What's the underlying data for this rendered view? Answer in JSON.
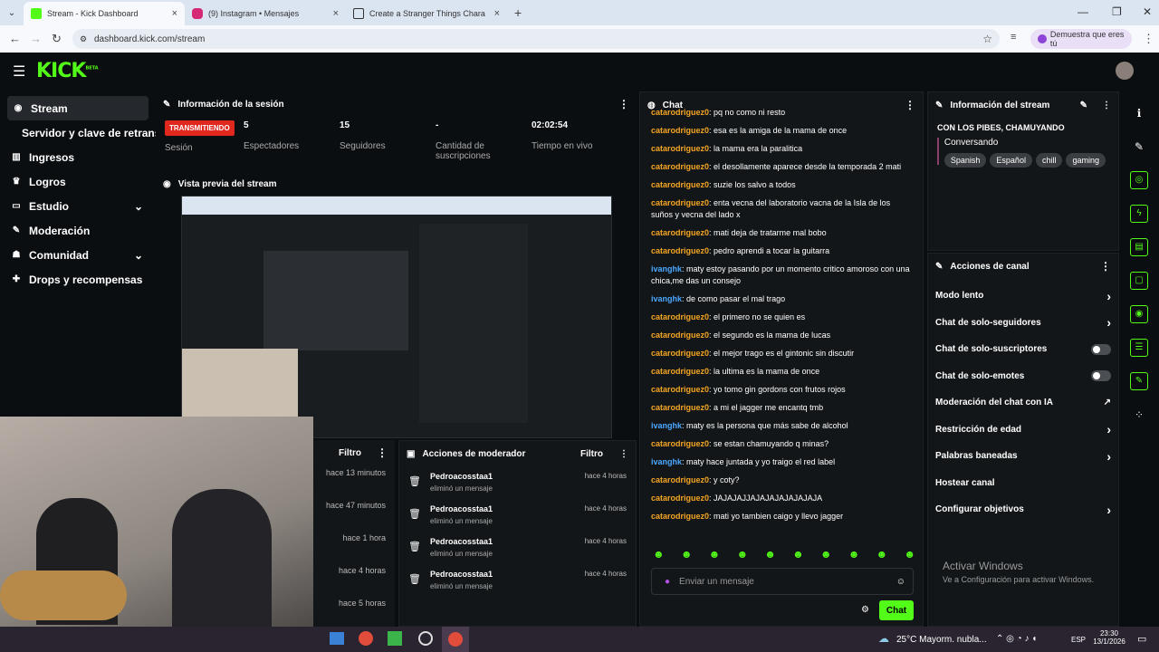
{
  "tabs": [
    {
      "title": "Stream - Kick Dashboard",
      "color": "#53fc18"
    },
    {
      "title": "(9) Instagram • Mensajes",
      "color": "#d62976"
    },
    {
      "title": "Create a Stranger Things Chara",
      "color": "#333333"
    }
  ],
  "address": {
    "url": "dashboard.kick.com/stream",
    "pill": "Demuestra que eres tú"
  },
  "logo": "KICK",
  "logo_sup": "BETA",
  "sidebar": [
    {
      "label": "Stream",
      "icon": "stream-icon",
      "active": true
    },
    {
      "label": "Servidor y clave de retransm",
      "icon": ""
    },
    {
      "label": "Ingresos",
      "icon": "chart-icon"
    },
    {
      "label": "Logros",
      "icon": "trophy-icon"
    },
    {
      "label": "Estudio",
      "icon": "studio-icon",
      "chevron": true
    },
    {
      "label": "Moderación",
      "icon": "wrench-icon"
    },
    {
      "label": "Comunidad",
      "icon": "people-icon",
      "chevron": true
    },
    {
      "label": "Drops y recompensas",
      "icon": "gift-icon"
    }
  ],
  "session": {
    "title": "Información de la sesión",
    "badge": "TRANSMITIENDO",
    "badge_label": "Sesión",
    "stats": [
      {
        "value": "5",
        "label": "Espectadores"
      },
      {
        "value": "15",
        "label": "Seguidores"
      },
      {
        "value": "-",
        "label": "Cantidad de suscripciones"
      },
      {
        "value": "02:02:54",
        "label": "Tiempo en vivo"
      }
    ]
  },
  "preview": {
    "title": "Vista previa del stream"
  },
  "filter_panel": {
    "label": "Filtro",
    "times": [
      "hace 13 minutos",
      "hace 47 minutos",
      "hace 1 hora",
      "hace 4 horas",
      "hace 5 horas"
    ]
  },
  "mod_actions": {
    "title": "Acciones de moderador",
    "filter": "Filtro",
    "items": [
      {
        "user": "Pedroacosstaa1",
        "action": "eliminó un mensaje",
        "time": "hace 4 horas"
      },
      {
        "user": "Pedroacosstaa1",
        "action": "eliminó un mensaje",
        "time": "hace 4 horas"
      },
      {
        "user": "Pedroacosstaa1",
        "action": "eliminó un mensaje",
        "time": "hace 4 horas"
      },
      {
        "user": "Pedroacosstaa1",
        "action": "eliminó un mensaje",
        "time": "hace 4 horas"
      }
    ]
  },
  "chat": {
    "title": "Chat",
    "messages": [
      {
        "user": "catarodriguez0",
        "text": "pq no como ni resto",
        "t": 1
      },
      {
        "user": "catarodriguez0",
        "text": "esa es la amiga de la mama de once",
        "t": 1
      },
      {
        "user": "catarodriguez0",
        "text": "la mama era la paralitica",
        "t": 1
      },
      {
        "user": "catarodriguez0",
        "text": "el desollamente aparece desde la temporada 2 mati",
        "t": 1
      },
      {
        "user": "catarodriguez0",
        "text": "suzie los salvo a todos",
        "t": 1
      },
      {
        "user": "catarodriguez0",
        "text": "enta vecna del laboratorio vacna de la Isla de los suños y vecna del lado x",
        "t": 1
      },
      {
        "user": "catarodriguez0",
        "text": "mati deja de tratarme mal bobo",
        "t": 1
      },
      {
        "user": "catarodriguez0",
        "text": "pedro aprendi a tocar la guitarra",
        "t": 1
      },
      {
        "user": "ivanghk",
        "text": "maty estoy pasando por un momento critico amoroso con una chica,me das un consejo",
        "t": 2
      },
      {
        "user": "ivanghk",
        "text": "de como pasar el mal trago",
        "t": 2
      },
      {
        "user": "catarodriguez0",
        "text": "el primero no se quien es",
        "t": 1
      },
      {
        "user": "catarodriguez0",
        "text": "el segundo es la mama de lucas",
        "t": 1
      },
      {
        "user": "catarodriguez0",
        "text": "el mejor trago es el gintonic sin discutir",
        "t": 1
      },
      {
        "user": "catarodriguez0",
        "text": "la ultima es la mama de once",
        "t": 1
      },
      {
        "user": "catarodriguez0",
        "text": "yo tomo gin gordons con frutos rojos",
        "t": 1
      },
      {
        "user": "catarodriguez0",
        "text": "a mi el jagger me encantq tmb",
        "t": 1
      },
      {
        "user": "ivanghk",
        "text": "maty es la persona que más sabe de alcohol",
        "t": 2
      },
      {
        "user": "catarodriguez0",
        "text": "se estan chamuyando q minas?",
        "t": 1
      },
      {
        "user": "ivanghk",
        "text": "maty hace juntada y yo traigo el red label",
        "t": 2
      },
      {
        "user": "catarodriguez0",
        "text": "y coty?",
        "t": 1
      },
      {
        "user": "catarodriguez0",
        "text": "JAJAJAJJAJAJAJAJAJAJAJA",
        "t": 1
      },
      {
        "user": "catarodriguez0",
        "text": "mati yo tambien caigo y llevo jagger",
        "t": 1
      }
    ],
    "placeholder": "Enviar un mensaje",
    "send": "Chat"
  },
  "stream_info": {
    "title": "Información del stream",
    "stream_title": "CON LOS PIBES, CHAMUYANDO",
    "category": "Conversando",
    "tags": [
      "Spanish",
      "Español",
      "chill",
      "gaming"
    ]
  },
  "channel_actions": {
    "title": "Acciones de canal",
    "items": [
      {
        "label": "Modo lento",
        "kind": "chev"
      },
      {
        "label": "Chat de solo-seguidores",
        "kind": "chev"
      },
      {
        "label": "Chat de solo-suscriptores",
        "kind": "toggle"
      },
      {
        "label": "Chat de solo-emotes",
        "kind": "toggle"
      },
      {
        "label": "Moderación del chat con IA",
        "kind": "ext"
      },
      {
        "label": "Restricción de edad",
        "kind": "chev"
      },
      {
        "label": "Palabras baneadas",
        "kind": "chev"
      },
      {
        "label": "Hostear canal",
        "kind": "none"
      },
      {
        "label": "Configurar objetivos",
        "kind": "chev"
      }
    ]
  },
  "watermark": {
    "title": "Activar Windows",
    "sub": "Ve a Configuración para activar Windows."
  },
  "taskbar": {
    "weather": "25°C  Mayorm. nubla...",
    "lang": "ESP",
    "time": "23:30",
    "date": "13/1/2026"
  },
  "colors": {
    "accent": "#53fc18",
    "user1": "#f5a623",
    "user2": "#4aa8ff",
    "badge": "#e0281f"
  }
}
